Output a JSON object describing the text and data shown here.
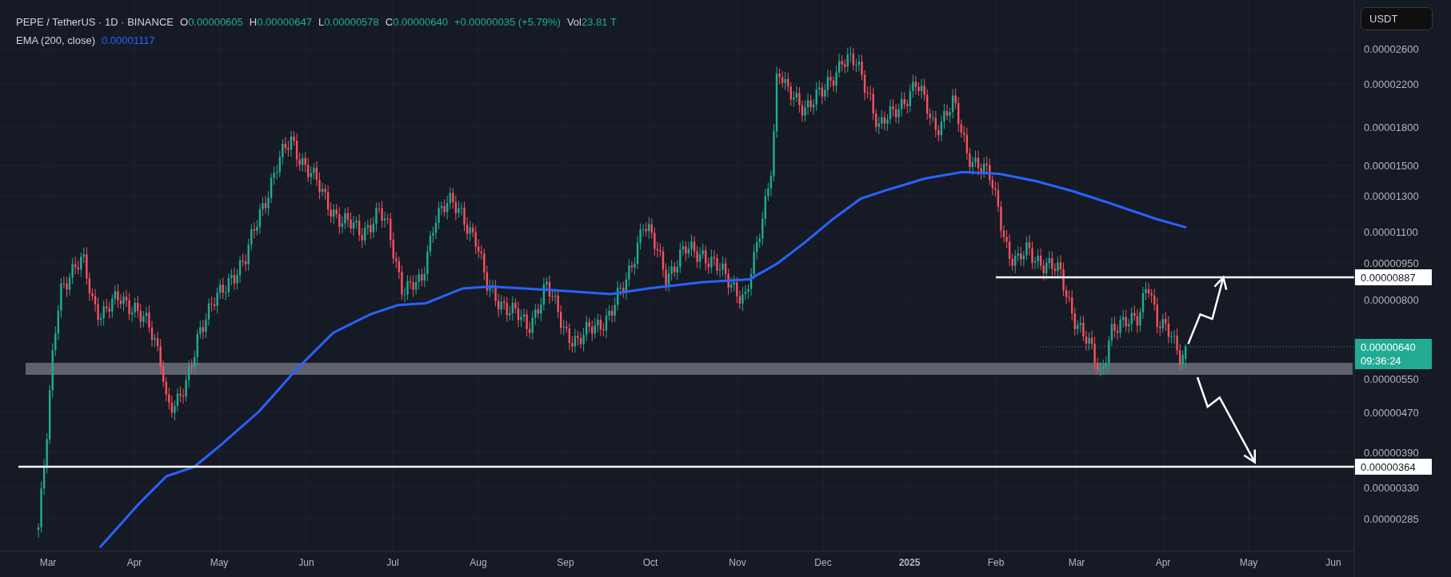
{
  "legend": {
    "symbol": "PEPE / TetherUS · 1D · BINANCE",
    "ohlc": [
      {
        "label": "O",
        "value": "0.00000605"
      },
      {
        "label": "H",
        "value": "0.00000647"
      },
      {
        "label": "L",
        "value": "0.00000578"
      },
      {
        "label": "C",
        "value": "0.00000640"
      }
    ],
    "change": "+0.00000035 (+5.79%)",
    "volume": {
      "label": "Vol",
      "value": "23.81 T"
    }
  },
  "indicator": {
    "name": "EMA (200, close)",
    "value": "0.00001117"
  },
  "currency_button": "USDT",
  "price_axis": {
    "labels": [
      "0.00002600",
      "0.00002200",
      "0.00001800",
      "0.00001500",
      "0.00001300",
      "0.00001100",
      "0.00000950",
      "0.00000800",
      "0.00000550",
      "0.00000470",
      "0.00000390",
      "0.00000330",
      "0.00000285"
    ]
  },
  "price_tags": [
    {
      "kind": "level",
      "price": "0.00000887"
    },
    {
      "kind": "current",
      "price": "0.00000640",
      "countdown": "09:36:24"
    },
    {
      "kind": "level",
      "price": "0.00000364"
    }
  ],
  "time_axis": {
    "labels": [
      {
        "text": "Mar",
        "kind": "month"
      },
      {
        "text": "Apr",
        "kind": "month"
      },
      {
        "text": "May",
        "kind": "month"
      },
      {
        "text": "Jun",
        "kind": "month"
      },
      {
        "text": "Jul",
        "kind": "month"
      },
      {
        "text": "Aug",
        "kind": "month"
      },
      {
        "text": "Sep",
        "kind": "month"
      },
      {
        "text": "Oct",
        "kind": "month"
      },
      {
        "text": "Nov",
        "kind": "month"
      },
      {
        "text": "Dec",
        "kind": "month"
      },
      {
        "text": "2025",
        "kind": "year"
      },
      {
        "text": "Feb",
        "kind": "month"
      },
      {
        "text": "Mar",
        "kind": "month"
      },
      {
        "text": "Apr",
        "kind": "month"
      },
      {
        "text": "May",
        "kind": "month"
      },
      {
        "text": "Jun",
        "kind": "month"
      }
    ]
  }
}
